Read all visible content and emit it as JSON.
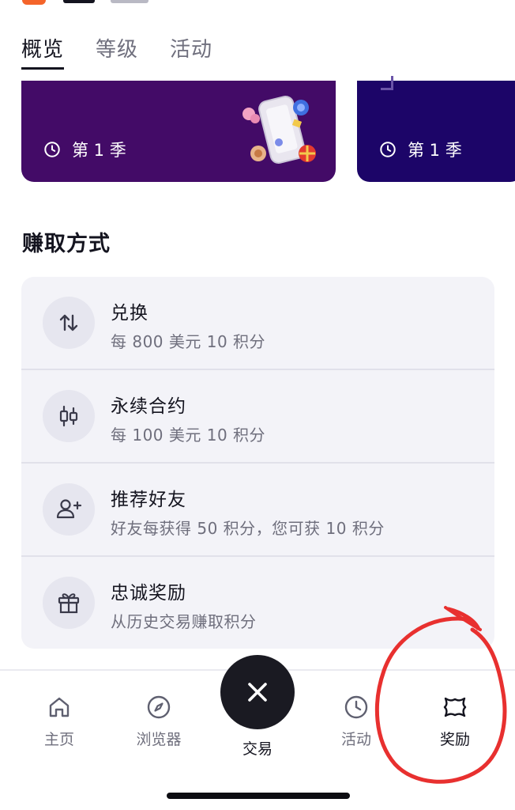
{
  "tabs": [
    {
      "label": "概览",
      "active": true
    },
    {
      "label": "等级",
      "active": false
    },
    {
      "label": "活动",
      "active": false
    }
  ],
  "season_cards": [
    {
      "season_label": "第 1 季",
      "bg": "#430b67"
    },
    {
      "season_label": "第 1 季",
      "bg": "#1c0568"
    }
  ],
  "earn": {
    "title": "赚取方式",
    "items": [
      {
        "title": "兑换",
        "subtitle": "每 800 美元 10 积分",
        "icon": "swap-arrows-icon"
      },
      {
        "title": "永续合约",
        "subtitle": "每 100 美元 10 积分",
        "icon": "candlestick-icon"
      },
      {
        "title": "推荐好友",
        "subtitle": "好友每获得 50 积分，您可获 10 积分",
        "icon": "add-user-icon"
      },
      {
        "title": "忠诚奖励",
        "subtitle": "从历史交易赚取积分",
        "icon": "gift-icon"
      }
    ]
  },
  "bottom_nav": {
    "home": "主页",
    "browser": "浏览器",
    "trade": "交易",
    "activity": "活动",
    "rewards": "奖励",
    "active": "rewards"
  },
  "colors": {
    "annotation": "#e8302f",
    "card_purple": "#430b67",
    "card_indigo": "#1c0568"
  }
}
